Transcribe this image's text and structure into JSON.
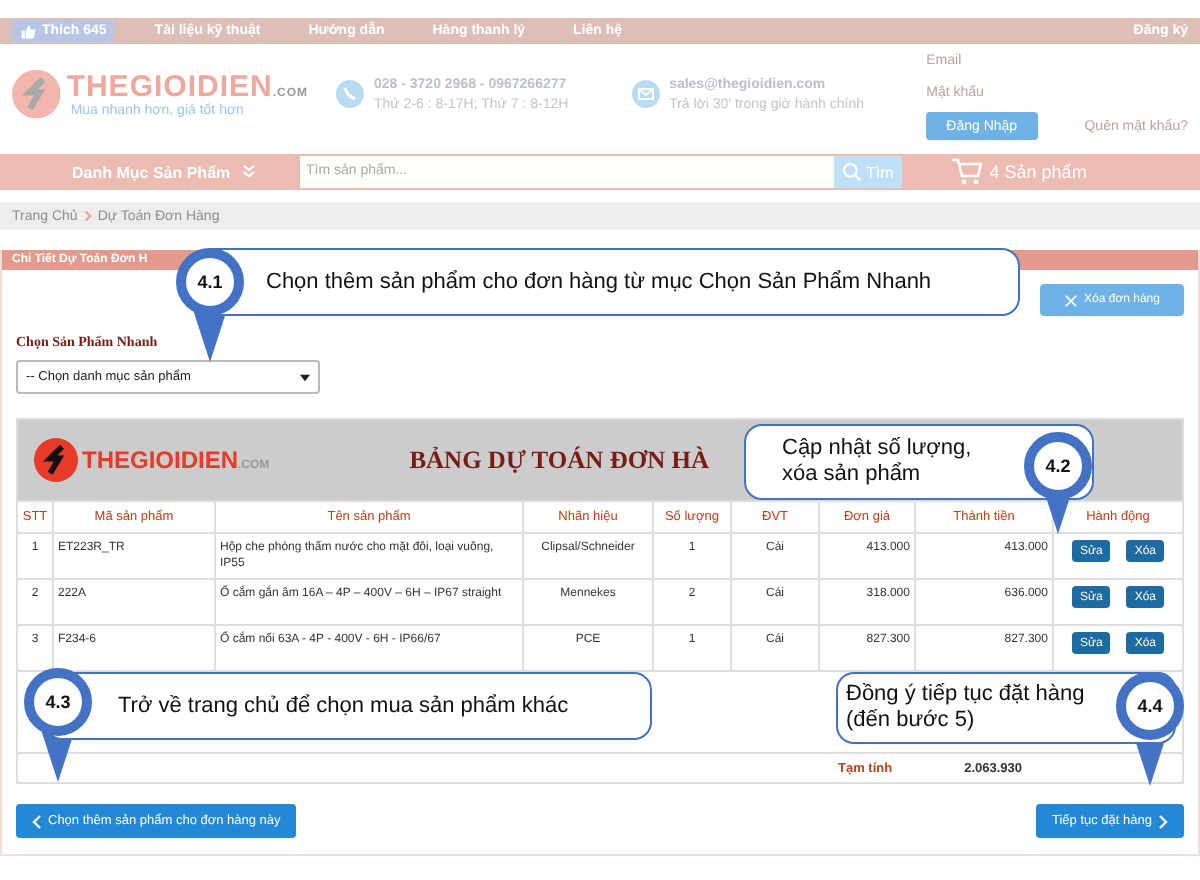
{
  "top_nav": {
    "like_button": "Thích 645",
    "links": [
      "Tài liệu kỹ thuật",
      "Hướng dẫn",
      "Hàng thanh lý",
      "Liên hệ"
    ],
    "register": "Đăng ký"
  },
  "header": {
    "logo_text": "THEGIOIDIEN",
    "logo_suffix": ".COM",
    "tagline": "Mua nhanh hơn, giá tốt hơn",
    "phone": "028 - 3720 2968 - 0967266277",
    "hours": "Thứ 2-6 : 8-17H; Thứ 7 : 8-12H",
    "email": "sales@thegioidien.com",
    "reply_note": "Trả lời 30' trong giờ hành chính",
    "login": {
      "email_placeholder": "Email",
      "password_placeholder": "Mật khẩu",
      "button": "Đăng Nhập",
      "forgot": "Quên mật khẩu?"
    }
  },
  "category_bar": {
    "menu": "Danh Mục Sản Phẩm",
    "search_placeholder": "Tìm sản phẩm...",
    "search_button": "Tìm",
    "cart": "4 Sản phẩm"
  },
  "breadcrumb": [
    "Trang Chủ",
    "Dự Toán Đơn Hàng"
  ],
  "panel": {
    "title": "Chi Tiết Dự Toán Đơn H",
    "clear_button": "Xóa đơn hàng",
    "quick_label": "Chọn Sản Phẩm Nhanh",
    "category_select": "-- Chọn danh mục sản phẩm"
  },
  "table": {
    "logo_text": "THEGIOIDIEN",
    "logo_suffix": ".COM",
    "title": "BẢNG DỰ TOÁN ĐƠN HÀ",
    "columns": [
      "STT",
      "Mã sản phẩm",
      "Tên sản phẩm",
      "Nhãn hiệu",
      "Số lượng",
      "ĐVT",
      "Đơn giá",
      "Thành tiền",
      "Hành động"
    ],
    "rows": [
      {
        "stt": "1",
        "code": "ET223R_TR",
        "name": "Hộp che phòng thấm nước cho mặt đôi, loại vuông, IP55",
        "brand": "Clipsal/Schneider",
        "qty": "1",
        "unit": "Cái",
        "price": "413.000",
        "total": "413.000",
        "actions": [
          "Sửa",
          "Xóa"
        ]
      },
      {
        "stt": "2",
        "code": "222A",
        "name": "Ổ cắm gắn âm 16A – 4P – 400V – 6H – IP67 straight",
        "brand": "Mennekes",
        "qty": "2",
        "unit": "Cái",
        "price": "318.000",
        "total": "636.000",
        "actions": [
          "Sửa",
          "Xóa"
        ]
      },
      {
        "stt": "3",
        "code": "F234-6",
        "name": "Ổ cắm nối 63A - 4P - 400V - 6H - IP66/67",
        "brand": "PCE",
        "qty": "1",
        "unit": "Cái",
        "price": "827.300",
        "total": "827.300",
        "actions": [
          "Sửa",
          "Xóa"
        ]
      }
    ],
    "subtotal_label": "Tạm tính",
    "subtotal": "2.063.930"
  },
  "buttons": {
    "back": "Chọn thêm sản phẩm cho đơn hàng này",
    "next": "Tiếp tục đặt hàng"
  },
  "callouts": [
    {
      "number": "4.1",
      "text": "Chọn thêm sản phẩm cho đơn hàng từ mục Chọn Sản Phẩm Nhanh"
    },
    {
      "number": "4.2",
      "text": "Cập nhật số lượng, xóa sản phẩm"
    },
    {
      "number": "4.3",
      "text": "Trở về trang chủ để chọn mua sản phẩm khác"
    },
    {
      "number": "4.4",
      "text": "Đồng ý tiếp tục đặt hàng (đến bước 5)"
    }
  ]
}
